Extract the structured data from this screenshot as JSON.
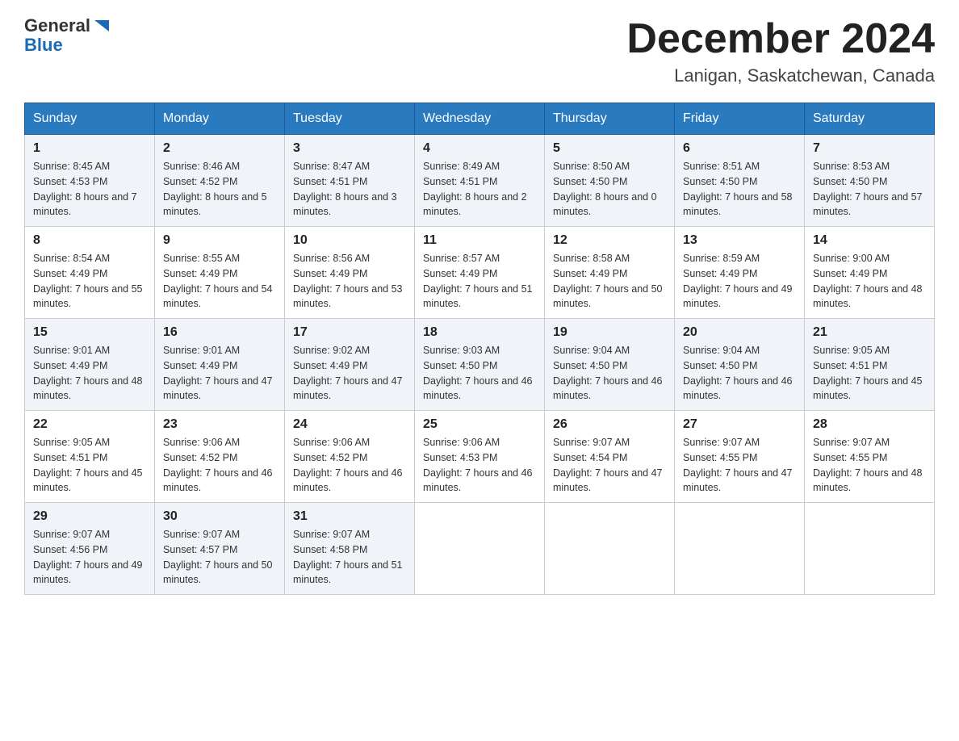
{
  "header": {
    "logo": {
      "general": "General",
      "blue": "Blue"
    },
    "title": "December 2024",
    "location": "Lanigan, Saskatchewan, Canada"
  },
  "weekdays": [
    "Sunday",
    "Monday",
    "Tuesday",
    "Wednesday",
    "Thursday",
    "Friday",
    "Saturday"
  ],
  "weeks": [
    [
      {
        "day": "1",
        "sunrise": "8:45 AM",
        "sunset": "4:53 PM",
        "daylight": "8 hours and 7 minutes."
      },
      {
        "day": "2",
        "sunrise": "8:46 AM",
        "sunset": "4:52 PM",
        "daylight": "8 hours and 5 minutes."
      },
      {
        "day": "3",
        "sunrise": "8:47 AM",
        "sunset": "4:51 PM",
        "daylight": "8 hours and 3 minutes."
      },
      {
        "day": "4",
        "sunrise": "8:49 AM",
        "sunset": "4:51 PM",
        "daylight": "8 hours and 2 minutes."
      },
      {
        "day": "5",
        "sunrise": "8:50 AM",
        "sunset": "4:50 PM",
        "daylight": "8 hours and 0 minutes."
      },
      {
        "day": "6",
        "sunrise": "8:51 AM",
        "sunset": "4:50 PM",
        "daylight": "7 hours and 58 minutes."
      },
      {
        "day": "7",
        "sunrise": "8:53 AM",
        "sunset": "4:50 PM",
        "daylight": "7 hours and 57 minutes."
      }
    ],
    [
      {
        "day": "8",
        "sunrise": "8:54 AM",
        "sunset": "4:49 PM",
        "daylight": "7 hours and 55 minutes."
      },
      {
        "day": "9",
        "sunrise": "8:55 AM",
        "sunset": "4:49 PM",
        "daylight": "7 hours and 54 minutes."
      },
      {
        "day": "10",
        "sunrise": "8:56 AM",
        "sunset": "4:49 PM",
        "daylight": "7 hours and 53 minutes."
      },
      {
        "day": "11",
        "sunrise": "8:57 AM",
        "sunset": "4:49 PM",
        "daylight": "7 hours and 51 minutes."
      },
      {
        "day": "12",
        "sunrise": "8:58 AM",
        "sunset": "4:49 PM",
        "daylight": "7 hours and 50 minutes."
      },
      {
        "day": "13",
        "sunrise": "8:59 AM",
        "sunset": "4:49 PM",
        "daylight": "7 hours and 49 minutes."
      },
      {
        "day": "14",
        "sunrise": "9:00 AM",
        "sunset": "4:49 PM",
        "daylight": "7 hours and 48 minutes."
      }
    ],
    [
      {
        "day": "15",
        "sunrise": "9:01 AM",
        "sunset": "4:49 PM",
        "daylight": "7 hours and 48 minutes."
      },
      {
        "day": "16",
        "sunrise": "9:01 AM",
        "sunset": "4:49 PM",
        "daylight": "7 hours and 47 minutes."
      },
      {
        "day": "17",
        "sunrise": "9:02 AM",
        "sunset": "4:49 PM",
        "daylight": "7 hours and 47 minutes."
      },
      {
        "day": "18",
        "sunrise": "9:03 AM",
        "sunset": "4:50 PM",
        "daylight": "7 hours and 46 minutes."
      },
      {
        "day": "19",
        "sunrise": "9:04 AM",
        "sunset": "4:50 PM",
        "daylight": "7 hours and 46 minutes."
      },
      {
        "day": "20",
        "sunrise": "9:04 AM",
        "sunset": "4:50 PM",
        "daylight": "7 hours and 46 minutes."
      },
      {
        "day": "21",
        "sunrise": "9:05 AM",
        "sunset": "4:51 PM",
        "daylight": "7 hours and 45 minutes."
      }
    ],
    [
      {
        "day": "22",
        "sunrise": "9:05 AM",
        "sunset": "4:51 PM",
        "daylight": "7 hours and 45 minutes."
      },
      {
        "day": "23",
        "sunrise": "9:06 AM",
        "sunset": "4:52 PM",
        "daylight": "7 hours and 46 minutes."
      },
      {
        "day": "24",
        "sunrise": "9:06 AM",
        "sunset": "4:52 PM",
        "daylight": "7 hours and 46 minutes."
      },
      {
        "day": "25",
        "sunrise": "9:06 AM",
        "sunset": "4:53 PM",
        "daylight": "7 hours and 46 minutes."
      },
      {
        "day": "26",
        "sunrise": "9:07 AM",
        "sunset": "4:54 PM",
        "daylight": "7 hours and 47 minutes."
      },
      {
        "day": "27",
        "sunrise": "9:07 AM",
        "sunset": "4:55 PM",
        "daylight": "7 hours and 47 minutes."
      },
      {
        "day": "28",
        "sunrise": "9:07 AM",
        "sunset": "4:55 PM",
        "daylight": "7 hours and 48 minutes."
      }
    ],
    [
      {
        "day": "29",
        "sunrise": "9:07 AM",
        "sunset": "4:56 PM",
        "daylight": "7 hours and 49 minutes."
      },
      {
        "day": "30",
        "sunrise": "9:07 AM",
        "sunset": "4:57 PM",
        "daylight": "7 hours and 50 minutes."
      },
      {
        "day": "31",
        "sunrise": "9:07 AM",
        "sunset": "4:58 PM",
        "daylight": "7 hours and 51 minutes."
      },
      null,
      null,
      null,
      null
    ]
  ]
}
